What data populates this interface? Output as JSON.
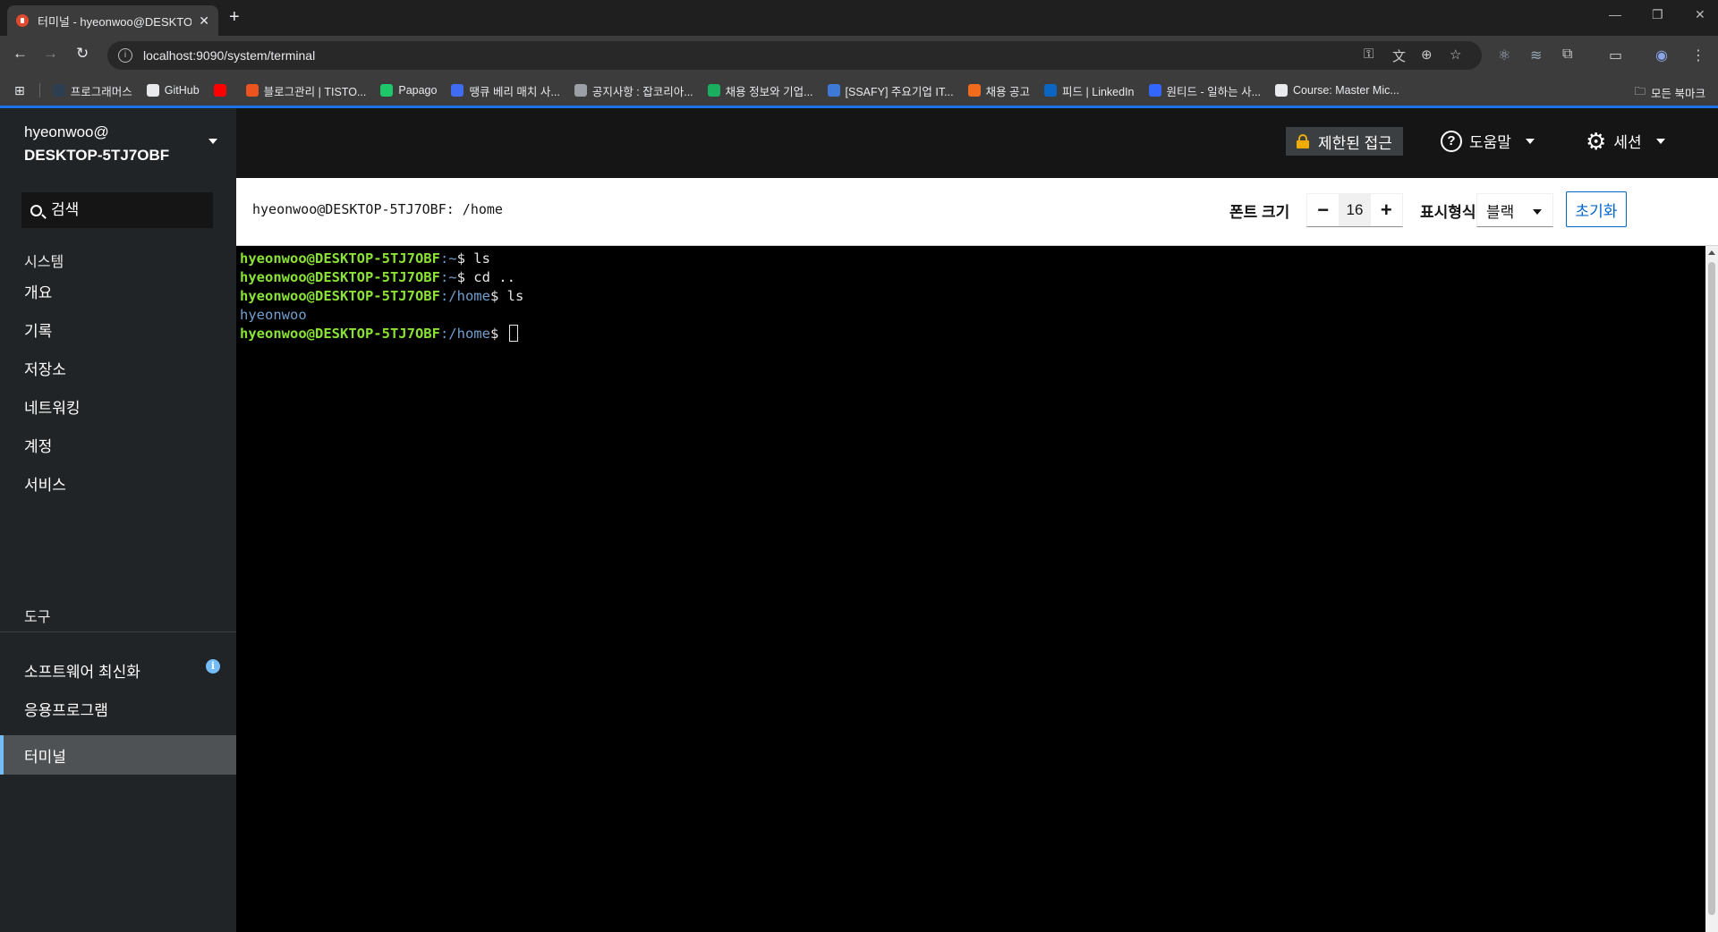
{
  "browser": {
    "tab_title": "터미널 - hyeonwoo@DESKTOP-5TJ7OBF",
    "tab_close": "✕",
    "new_tab": "+",
    "url": "localhost:9090/system/terminal",
    "window_controls": [
      "—",
      "❐",
      "✕"
    ],
    "bookmarks": [
      {
        "label": "프로그래머스",
        "color": "#2d3e50"
      },
      {
        "label": "GitHub",
        "color": "#e8eaed"
      },
      {
        "label": "",
        "color": "#ff0000"
      },
      {
        "label": "블로그관리 | TISTO...",
        "color": "#eb531f"
      },
      {
        "label": "Papago",
        "color": "#1fc76b"
      },
      {
        "label": "땡큐 베리 매치 사...",
        "color": "#3f6cf0"
      },
      {
        "label": "공지사항 : 잡코리아...",
        "color": "#9aa0a6"
      },
      {
        "label": "채용 정보와 기업...",
        "color": "#1aae5f"
      },
      {
        "label": "[SSAFY] 주요기업 IT...",
        "color": "#3f79d8"
      },
      {
        "label": "채용 공고",
        "color": "#f26b1d"
      },
      {
        "label": "피드 | LinkedIn",
        "color": "#0a66c2"
      },
      {
        "label": "원티드 - 일하는 사...",
        "color": "#3366ff"
      },
      {
        "label": "Course: Master Mic...",
        "color": "#e8eaed"
      }
    ],
    "all_bookmarks": "모든 북마크"
  },
  "sidebar": {
    "host_user": "hyeonwoo@",
    "host_name": "DESKTOP-5TJ7OBF",
    "search_placeholder": "검색",
    "section_system": "시스템",
    "items_system": [
      "개요",
      "기록",
      "저장소",
      "네트워킹",
      "계정",
      "서비스"
    ],
    "section_tools": "도구",
    "items_tools": [
      "소프트웨어 최신화",
      "응용프로그램",
      "터미널"
    ],
    "update_badge": "i",
    "active_item": "터미널"
  },
  "masthead": {
    "restricted_label": "제한된 접근",
    "help_label": "도움말",
    "session_label": "세션"
  },
  "terminal_header": {
    "path": "hyeonwoo@DESKTOP-5TJ7OBF: /home",
    "font_size_label": "폰트 크기",
    "decrease": "−",
    "font_size": "16",
    "increase": "+",
    "theme_label": "표시형식",
    "theme_value": "블랙",
    "reset_label": "초기화"
  },
  "terminal": {
    "lines": [
      {
        "user": "hyeonwoo@DESKTOP-5TJ7OBF",
        "path": ":~",
        "cmd": "$ ls"
      },
      {
        "user": "hyeonwoo@DESKTOP-5TJ7OBF",
        "path": ":~",
        "cmd": "$ cd .."
      },
      {
        "user": "hyeonwoo@DESKTOP-5TJ7OBF",
        "path": ":/home",
        "cmd": "$ ls"
      },
      {
        "output": "hyeonwoo"
      },
      {
        "user": "hyeonwoo@DESKTOP-5TJ7OBF",
        "path": ":/home",
        "cmd": "$ "
      }
    ]
  },
  "colors": {
    "prompt_user": "#8ae234",
    "prompt_path": "#729fcf",
    "accent": "#73bcf7",
    "link_blue": "#0066cc",
    "lock": "#f0ab00"
  }
}
